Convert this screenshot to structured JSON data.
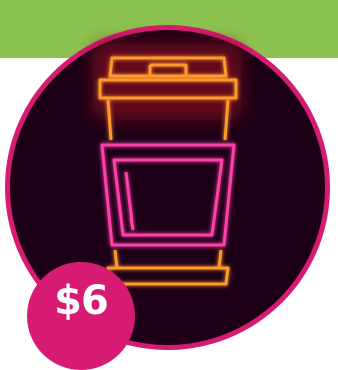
{
  "price": {
    "label": "$6"
  },
  "colors": {
    "banner_green": "#8cc24f",
    "circle_fill": "#1d0017",
    "circle_border": "#d81b72",
    "badge_fill": "#d81b72",
    "neon_orange": "#ff9a2c",
    "neon_pink": "#ff3fa8",
    "neon_glow_red": "#7a0a1c"
  },
  "illustration": {
    "icon": "neon-coffee-cup-icon"
  }
}
